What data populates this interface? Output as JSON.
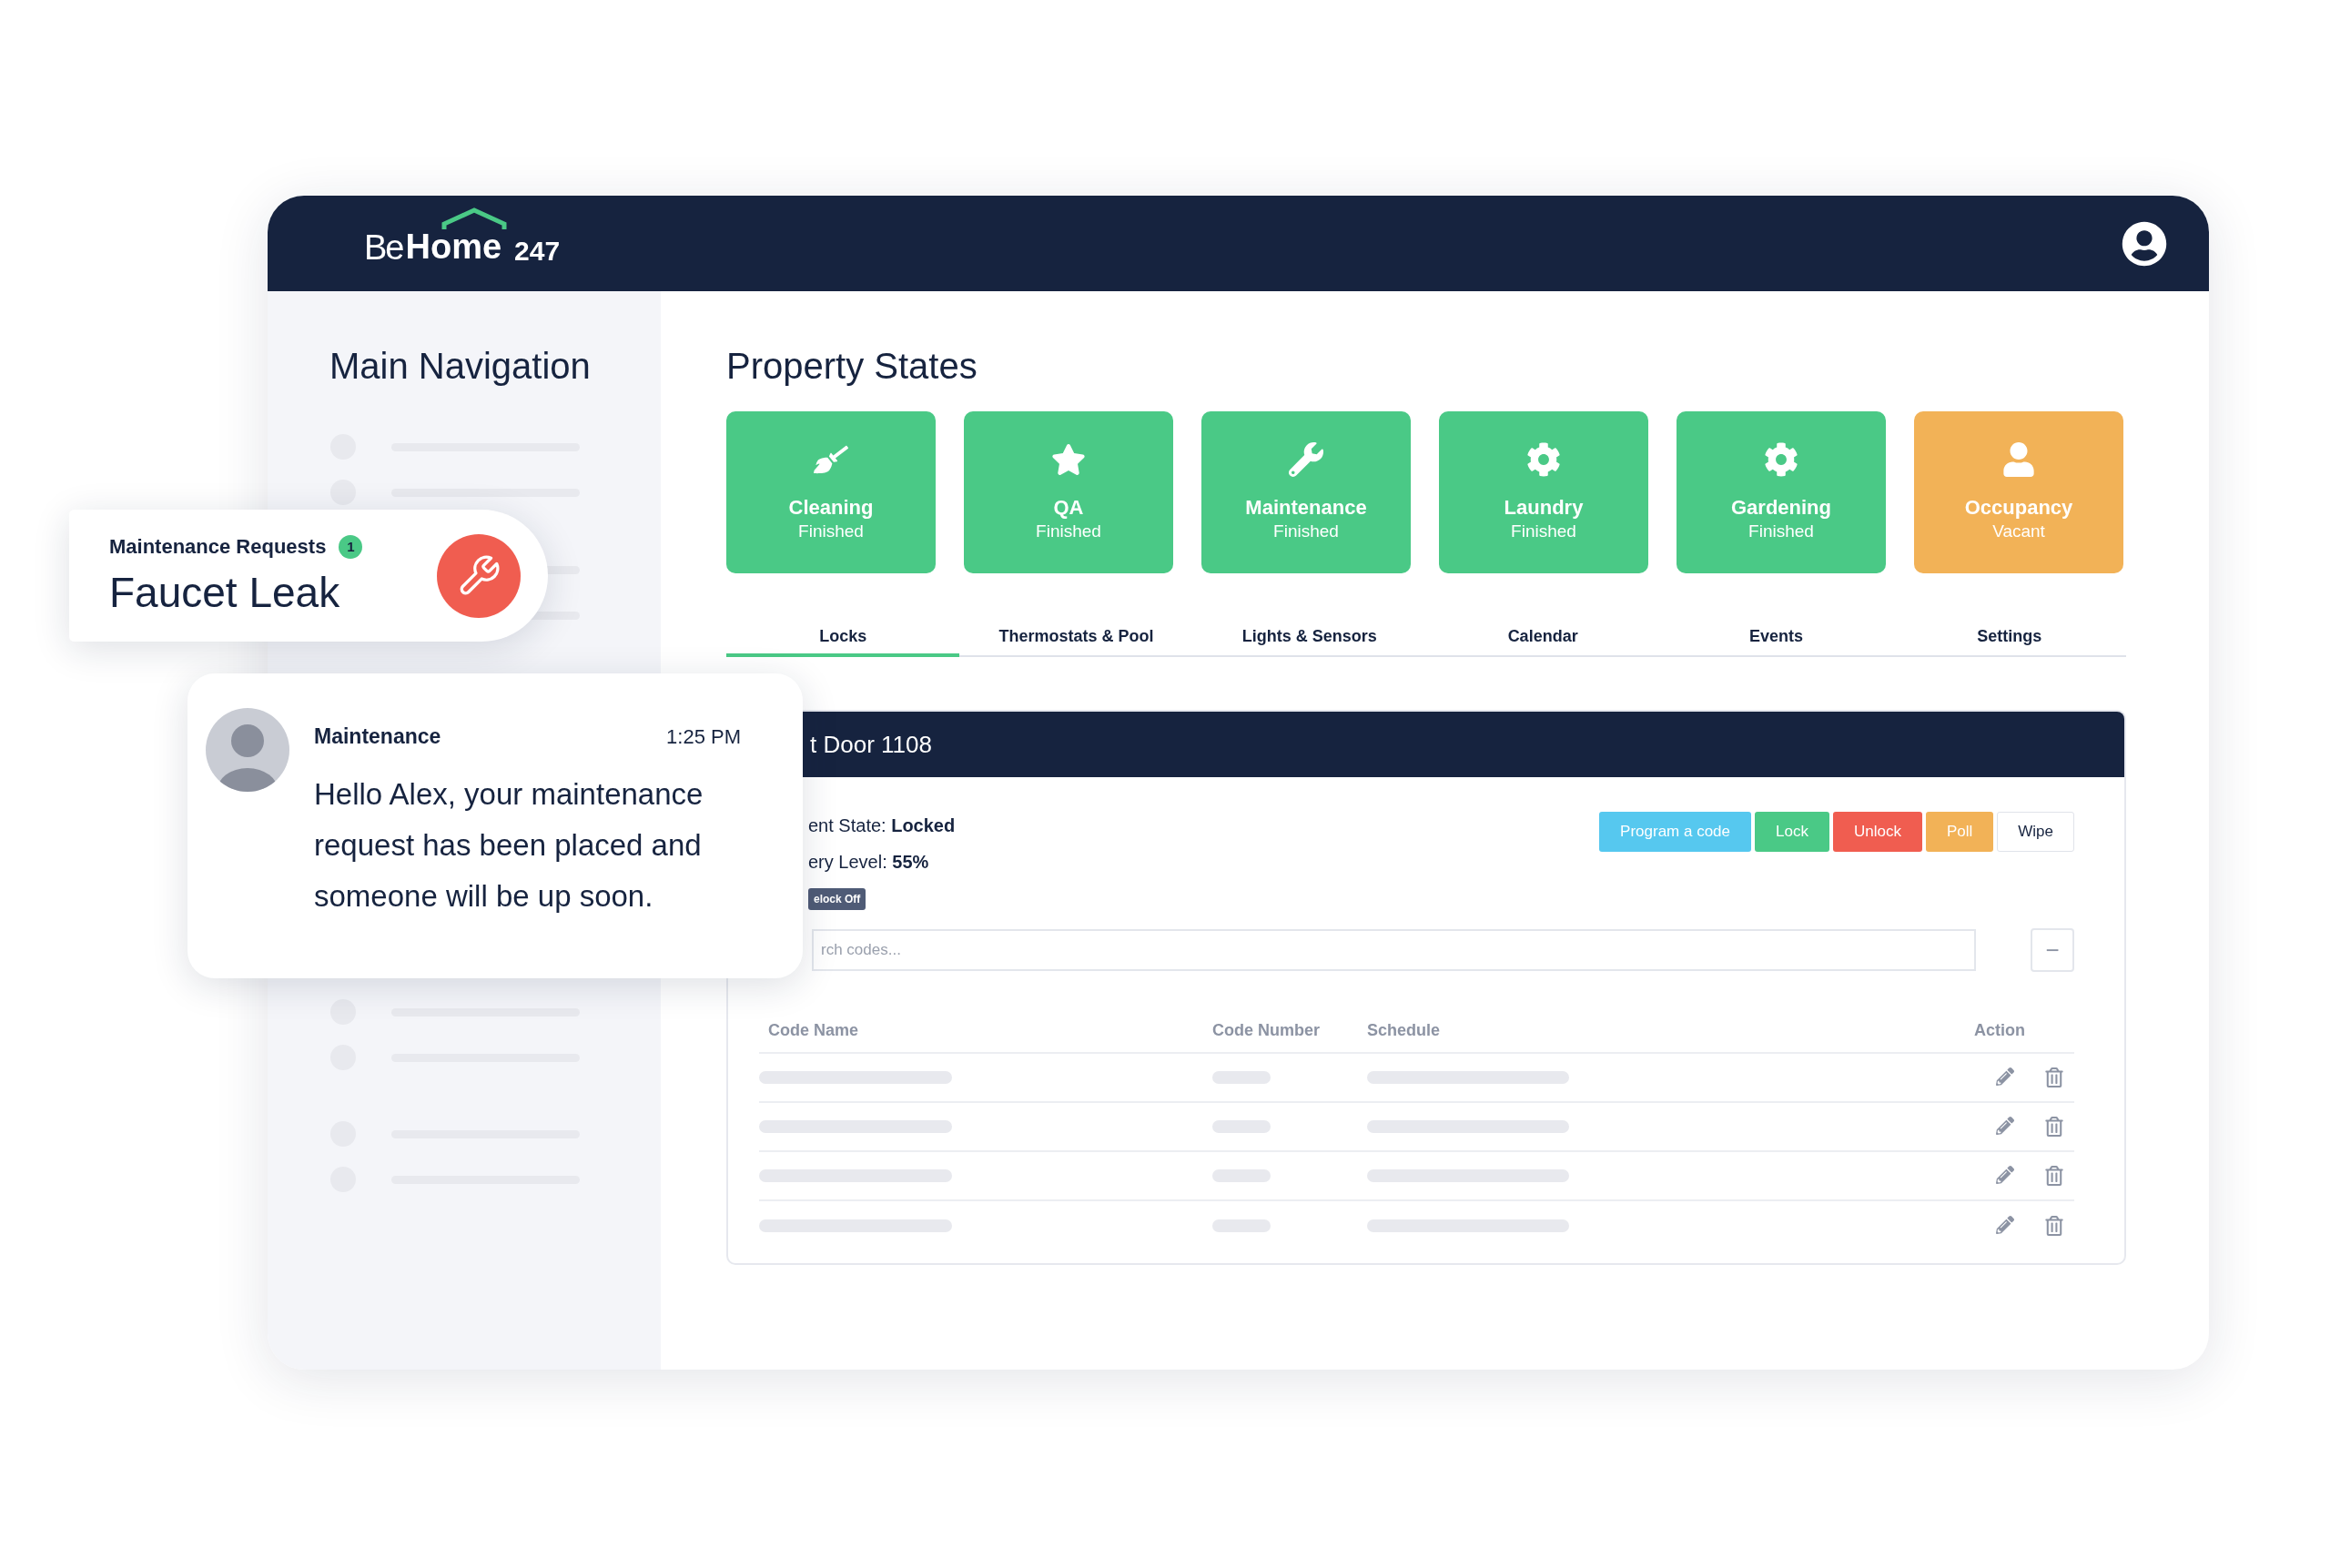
{
  "header": {
    "logo": {
      "be": "Be",
      "home": "Home",
      "number": "247"
    }
  },
  "sidebar": {
    "title": "Main Navigation"
  },
  "main": {
    "title": "Property States",
    "tiles": [
      {
        "kind": "broom",
        "label": "Cleaning",
        "status": "Finished",
        "color": "#4ac986"
      },
      {
        "kind": "star",
        "label": "QA",
        "status": "Finished",
        "color": "#4ac986"
      },
      {
        "kind": "wrench",
        "label": "Maintenance",
        "status": "Finished",
        "color": "#4ac986"
      },
      {
        "kind": "gear",
        "label": "Laundry",
        "status": "Finished",
        "color": "#4ac986"
      },
      {
        "kind": "gear",
        "label": "Gardening",
        "status": "Finished",
        "color": "#4ac986"
      },
      {
        "kind": "person",
        "label": "Occupancy",
        "status": "Vacant",
        "color": "#f2b257"
      }
    ],
    "tabs": [
      {
        "label": "Locks",
        "selected": true
      },
      {
        "label": "Thermostats & Pool",
        "selected": false
      },
      {
        "label": "Lights & Sensors",
        "selected": false
      },
      {
        "label": "Calendar",
        "selected": false
      },
      {
        "label": "Events",
        "selected": false
      },
      {
        "label": "Settings",
        "selected": false
      }
    ],
    "lock_panel": {
      "title": "t Door 1108",
      "state": {
        "label": "ent State:",
        "value": "Locked"
      },
      "battery": {
        "label": "ery Level:",
        "value": "55%"
      },
      "badge": "elock Off",
      "buttons": [
        {
          "label": "Program a code",
          "color": "#56c8ef"
        },
        {
          "label": "Lock",
          "color": "#4ac986"
        },
        {
          "label": "Unlock",
          "color": "#f05d50"
        },
        {
          "label": "Poll",
          "color": "#f2b257"
        },
        {
          "label": "Wipe",
          "color": "#ffffff"
        }
      ],
      "search": {
        "placeholder": "rch codes..."
      },
      "collapse_button": "−",
      "table": {
        "columns": [
          "Code Name",
          "Code Number",
          "Schedule",
          "Action"
        ]
      }
    }
  },
  "request_card": {
    "title": "Maintenance Requests",
    "count": "1",
    "subject": "Faucet Leak"
  },
  "message_card": {
    "sender": "Maintenance",
    "time": "1:25 PM",
    "text": "Hello Alex, your maintenance request has been placed and someone will be up soon."
  }
}
